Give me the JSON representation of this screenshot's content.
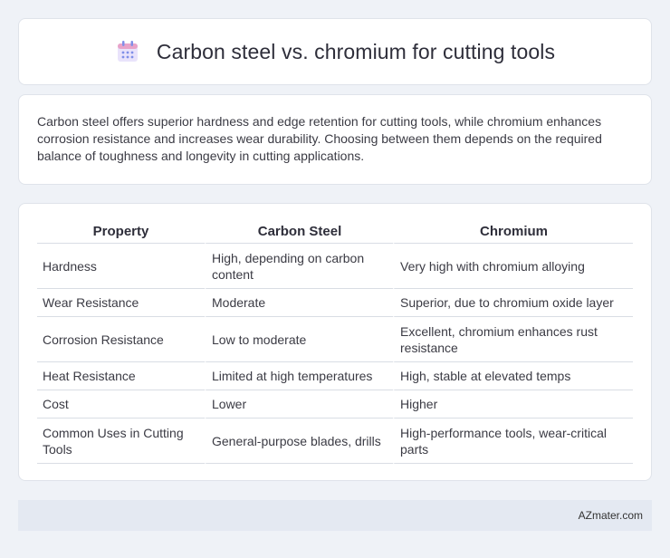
{
  "header": {
    "title": "Carbon steel vs. chromium for cutting tools",
    "icon": "calendar-icon"
  },
  "summary": {
    "text": "Carbon steel offers superior hardness and edge retention for cutting tools, while chromium enhances corrosion resistance and increases wear durability. Choosing between them depends on the required balance of toughness and longevity in cutting applications."
  },
  "table": {
    "headers": [
      "Property",
      "Carbon Steel",
      "Chromium"
    ],
    "rows": [
      [
        "Hardness",
        "High, depending on carbon content",
        "Very high with chromium alloying"
      ],
      [
        "Wear Resistance",
        "Moderate",
        "Superior, due to chromium oxide layer"
      ],
      [
        "Corrosion Resistance",
        "Low to moderate",
        "Excellent, chromium enhances rust resistance"
      ],
      [
        "Heat Resistance",
        "Limited at high temperatures",
        "High, stable at elevated temps"
      ],
      [
        "Cost",
        "Lower",
        "Higher"
      ],
      [
        "Common Uses in Cutting Tools",
        "General-purpose blades, drills",
        "High-performance tools, wear-critical parts"
      ]
    ]
  },
  "footer": {
    "text": "AZmater.com"
  },
  "colors": {
    "background": "#eff2f7",
    "card": "#ffffff",
    "footer_bg": "#e4e9f2",
    "icon_pink": "#e8a3c9",
    "icon_blue": "#7f8fe8"
  }
}
